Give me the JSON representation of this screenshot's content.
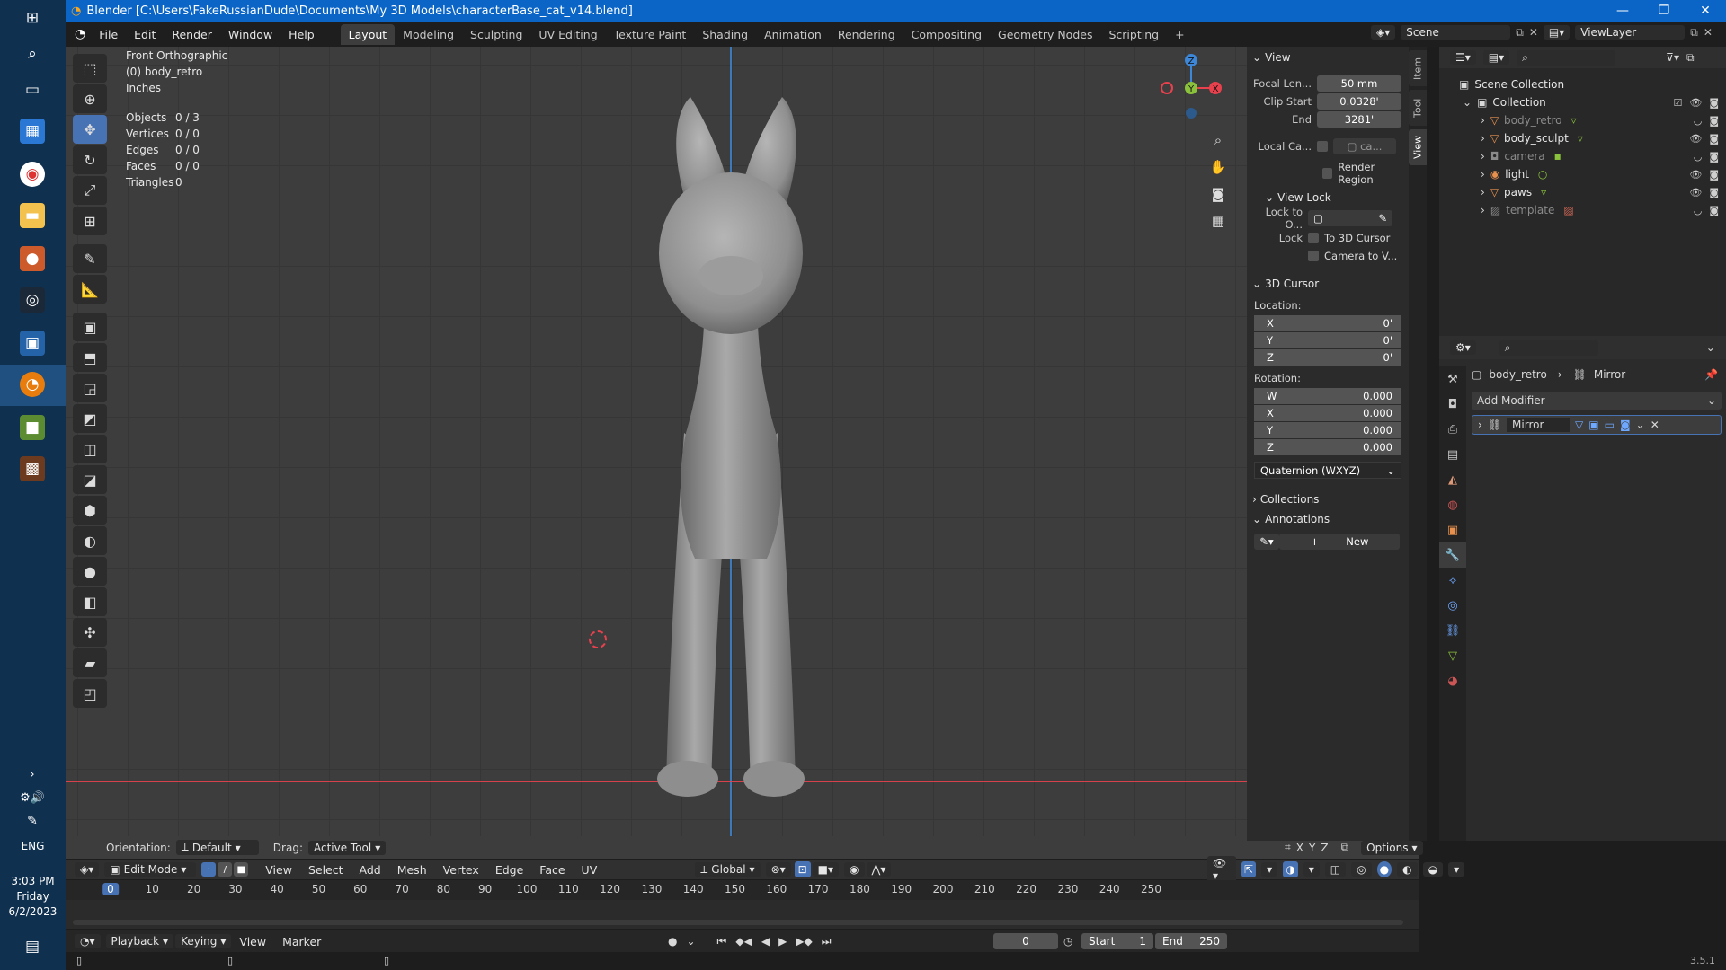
{
  "window": {
    "title": "Blender [C:\\Users\\FakeRussianDude\\Documents\\My 3D Models\\characterBase_cat_v14.blend]"
  },
  "taskbar": {
    "time": "3:03 PM",
    "day": "Friday",
    "date": "6/2/2023",
    "lang": "ENG"
  },
  "menu": {
    "items": [
      "File",
      "Edit",
      "Render",
      "Window",
      "Help"
    ]
  },
  "workspaces": {
    "tabs": [
      "Layout",
      "Modeling",
      "Sculpting",
      "UV Editing",
      "Texture Paint",
      "Shading",
      "Animation",
      "Rendering",
      "Compositing",
      "Geometry Nodes",
      "Scripting"
    ],
    "add": "+"
  },
  "scene": {
    "label": "Scene",
    "view_layer": "ViewLayer"
  },
  "viewport": {
    "view_name": "Front Orthographic",
    "object": "(0) body_retro",
    "units": "Inches",
    "stats": {
      "objects_label": "Objects",
      "objects_value": "0 / 3",
      "vertices_label": "Vertices",
      "vertices_value": "0 / 0",
      "edges_label": "Edges",
      "edges_value": "0 / 0",
      "faces_label": "Faces",
      "faces_value": "0 / 0",
      "triangles_label": "Triangles",
      "triangles_value": "0"
    },
    "gizmo": {
      "z": "Z",
      "y": "Y",
      "x": "X"
    }
  },
  "npanel": {
    "tabs": [
      "Item",
      "Tool",
      "View"
    ],
    "view": {
      "header": "View",
      "focal_label": "Focal Len...",
      "focal_value": "50 mm",
      "clip_start_label": "Clip Start",
      "clip_start_value": "0.0328'",
      "end_label": "End",
      "end_value": "3281'",
      "local_cam_label": "Local Ca...",
      "local_cam_value": "ca...",
      "render_region": "Render Region"
    },
    "view_lock": {
      "header": "View Lock",
      "lock_to_label": "Lock to O...",
      "lock_label": "Lock",
      "to_cursor": "To 3D Cursor",
      "camera_to_view": "Camera to V..."
    },
    "cursor": {
      "header": "3D Cursor",
      "location_label": "Location:",
      "location": [
        {
          "axis": "X",
          "value": "0'"
        },
        {
          "axis": "Y",
          "value": "0'"
        },
        {
          "axis": "Z",
          "value": "0'"
        }
      ],
      "rotation_label": "Rotation:",
      "rotation": [
        {
          "axis": "W",
          "value": "0.000"
        },
        {
          "axis": "X",
          "value": "0.000"
        },
        {
          "axis": "Y",
          "value": "0.000"
        },
        {
          "axis": "Z",
          "value": "0.000"
        }
      ],
      "rotation_mode": "Quaternion (WXYZ)"
    },
    "collections": "Collections",
    "annotations": {
      "header": "Annotations",
      "new": "New"
    }
  },
  "outliner": {
    "root": "Scene Collection",
    "collection": "Collection",
    "items": [
      {
        "name": "body_retro",
        "dim": true
      },
      {
        "name": "body_sculpt",
        "dim": false
      },
      {
        "name": "camera",
        "dim": true
      },
      {
        "name": "light",
        "dim": false
      },
      {
        "name": "paws",
        "dim": false
      },
      {
        "name": "template",
        "dim": true
      }
    ]
  },
  "properties": {
    "breadcrumb_object": "body_retro",
    "breadcrumb_modifier": "Mirror",
    "add_modifier": "Add Modifier",
    "modifier_name": "Mirror"
  },
  "tool_settings": {
    "orientation_label": "Orientation:",
    "orientation_value": "Default",
    "drag_label": "Drag:",
    "drag_value": "Active Tool",
    "axes": [
      "X",
      "Y",
      "Z"
    ],
    "options": "Options"
  },
  "header": {
    "mode": "Edit Mode",
    "menus": [
      "View",
      "Select",
      "Add",
      "Mesh",
      "Vertex",
      "Edge",
      "Face",
      "UV"
    ],
    "transform": "Global"
  },
  "timeline": {
    "ticks": [
      "0",
      "10",
      "20",
      "30",
      "40",
      "50",
      "60",
      "70",
      "80",
      "90",
      "100",
      "110",
      "120",
      "130",
      "140",
      "150",
      "160",
      "170",
      "180",
      "190",
      "200",
      "210",
      "220",
      "230",
      "240",
      "250"
    ],
    "current_frame": "0",
    "menus": [
      "Playback",
      "Keying",
      "View",
      "Marker"
    ],
    "frame_field": "0",
    "start_label": "Start",
    "start_value": "1",
    "end_label": "End",
    "end_value": "250"
  },
  "status": {
    "version": "3.5.1"
  },
  "colors": {
    "accent": "#4772b3",
    "axis_x": "#e8414e",
    "axis_y": "#8bc23c",
    "axis_z": "#3d87d8",
    "titlebar": "#0a65c7"
  }
}
